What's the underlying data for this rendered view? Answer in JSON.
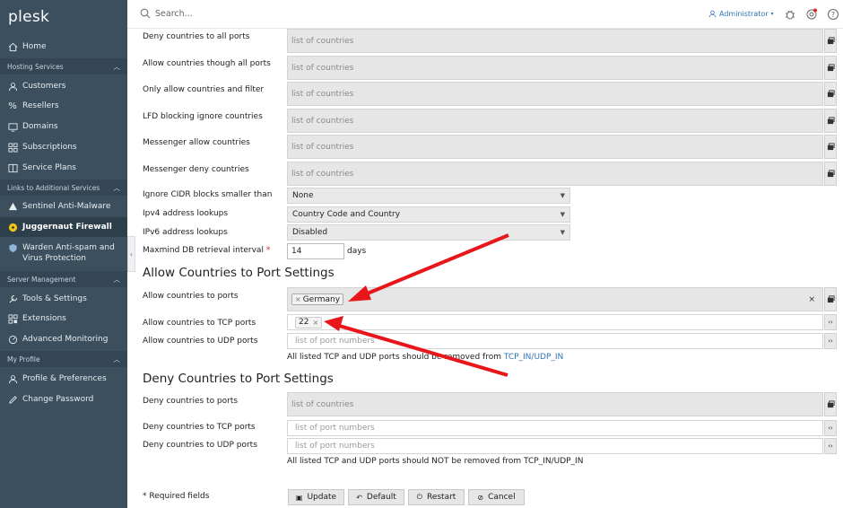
{
  "app": {
    "logo": "plesk"
  },
  "sidebar": {
    "home": "Home",
    "sec_hosting": "Hosting Services",
    "customers": "Customers",
    "resellers": "Resellers",
    "domains": "Domains",
    "subscriptions": "Subscriptions",
    "service_plans": "Service Plans",
    "sec_links": "Links to Additional Services",
    "sentinel": "Sentinel Anti-Malware",
    "juggernaut": "Juggernaut Firewall",
    "warden_1": "Warden Anti-spam and",
    "warden_2": "Virus Protection",
    "sec_server": "Server Management",
    "tools": "Tools & Settings",
    "extensions": "Extensions",
    "monitoring": "Advanced Monitoring",
    "sec_profile": "My Profile",
    "profile": "Profile & Preferences",
    "password": "Change Password"
  },
  "topbar": {
    "search_placeholder": "Search...",
    "user": "Administrator"
  },
  "form": {
    "placeholder_countries": "list of countries",
    "placeholder_ports": "list of port numbers",
    "rows": [
      {
        "label": "Deny countries to all ports"
      },
      {
        "label": "Allow countries though all ports"
      },
      {
        "label": "Only allow countries and filter"
      },
      {
        "label": "LFD blocking ignore countries"
      },
      {
        "label": "Messenger allow countries"
      },
      {
        "label": "Messenger deny countries"
      }
    ],
    "cidr": {
      "label": "Ignore CIDR blocks smaller than",
      "value": "None"
    },
    "ipv4": {
      "label": "Ipv4 address lookups",
      "value": "Country Code and Country"
    },
    "ipv6": {
      "label": "IPv6 address lookups",
      "value": "Disabled"
    },
    "maxmind": {
      "label": "Maxmind DB retrieval interval",
      "required": "*",
      "value": "14",
      "unit": "days"
    },
    "allow_section": "Allow Countries to Port Settings",
    "allow_ports": {
      "label": "Allow countries to ports",
      "tag": "Germany"
    },
    "allow_tcp": {
      "label": "Allow countries to TCP ports",
      "tag": "22"
    },
    "allow_udp": {
      "label": "Allow countries to UDP ports"
    },
    "allow_note": "All listed TCP and UDP ports should be removed from ",
    "allow_note_link": "TCP_IN/UDP_IN",
    "deny_section": "Deny Countries to Port Settings",
    "deny_ports": {
      "label": "Deny countries to ports"
    },
    "deny_tcp": {
      "label": "Deny countries to TCP ports"
    },
    "deny_udp": {
      "label": "Deny countries to UDP ports"
    },
    "deny_note": "All listed TCP and UDP ports should NOT be removed from TCP_IN/UDP_IN",
    "required_note": "* Required fields"
  },
  "buttons": {
    "update": "Update",
    "default": "Default",
    "restart": "Restart",
    "cancel": "Cancel"
  },
  "colors": {
    "sidebar": "#3b4f5f",
    "link": "#2f74b5",
    "arrow": "#e8151b"
  }
}
